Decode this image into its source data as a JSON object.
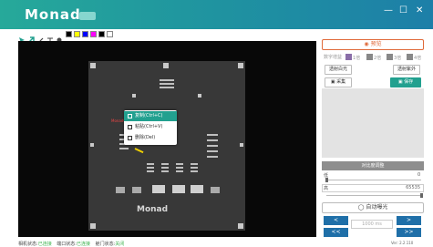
{
  "app": {
    "title": "Monad",
    "window_controls": [
      "—",
      "☐",
      "✕"
    ],
    "brand_color": "#22a08f"
  },
  "toolbar": {
    "tools": [
      "select-icon",
      "arrow-icon",
      "pen-icon",
      "text-icon",
      "dot-icon"
    ],
    "swatch_colors": [
      "#000000",
      "#ffff00",
      "#0000ff",
      "#ff00ff",
      "#000000",
      "#ffffff"
    ]
  },
  "viewer": {
    "sample_label": "Monad",
    "annotation_text": "Monad001"
  },
  "context_menu": {
    "items": [
      {
        "label": "复制(Ctrl+C)",
        "icon": "copy-icon"
      },
      {
        "label": "粘贴(Ctrl+V)",
        "icon": "paste-icon"
      },
      {
        "label": "删除(Del)",
        "icon": "delete-icon"
      }
    ]
  },
  "panel": {
    "preview_button": "预览",
    "digital_gain_label": "数字增益",
    "gain_options": [
      "1倍",
      "2倍",
      "3倍",
      "4倍"
    ],
    "transmit_white": "透射白光",
    "transmit_uv": "透射紫外",
    "capture_button": "采集",
    "save_button": "保存",
    "contrast_button": "对比度调整",
    "low_label": "低",
    "low_value": "0",
    "high_label": "高",
    "high_value": "65535",
    "auto_exposure": "自动曝光",
    "prev": "<",
    "prev_fast": "<<",
    "next": ">",
    "next_fast": ">>",
    "speed_value": "1000",
    "speed_unit": "ms"
  },
  "status_bar": {
    "items": [
      {
        "label": "相机状态:",
        "value": "已连接"
      },
      {
        "label": "端口状态:",
        "value": "已连接"
      },
      {
        "label": "舱门状态:",
        "value": "关闭"
      }
    ],
    "version": "Ver: 2.2.110"
  }
}
